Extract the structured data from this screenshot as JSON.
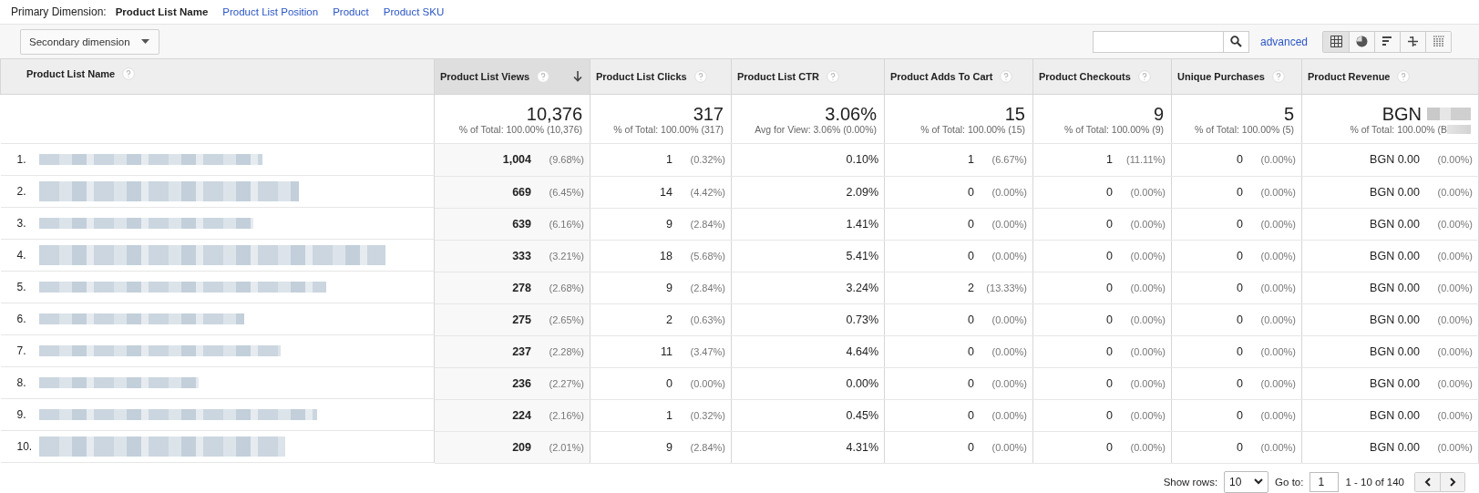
{
  "primary_dimension": {
    "label": "Primary Dimension:",
    "options": [
      {
        "label": "Product List Name",
        "selected": true
      },
      {
        "label": "Product List Position",
        "selected": false
      },
      {
        "label": "Product",
        "selected": false
      },
      {
        "label": "Product SKU",
        "selected": false
      }
    ]
  },
  "toolbar": {
    "secondary_dimension": "Secondary dimension",
    "advanced": "advanced",
    "views": [
      {
        "kind": "table",
        "selected": true
      },
      {
        "kind": "pie",
        "selected": false
      },
      {
        "kind": "performance",
        "selected": false
      },
      {
        "kind": "comparison",
        "selected": false
      },
      {
        "kind": "pivot",
        "selected": false
      }
    ]
  },
  "table": {
    "columns": [
      {
        "label": "Product List Name",
        "sorted": false
      },
      {
        "label": "Product List Views",
        "sorted": true
      },
      {
        "label": "Product List Clicks",
        "sorted": false
      },
      {
        "label": "Product List CTR",
        "sorted": false
      },
      {
        "label": "Product Adds To Cart",
        "sorted": false
      },
      {
        "label": "Product Checkouts",
        "sorted": false
      },
      {
        "label": "Unique Purchases",
        "sorted": false
      },
      {
        "label": "Product Revenue",
        "sorted": false
      }
    ],
    "totals": [
      {
        "kind": "blank"
      },
      {
        "kind": "number",
        "value": "10,376",
        "note": "% of Total: 100.00% (10,376)"
      },
      {
        "kind": "number",
        "value": "317",
        "note": "% of Total: 100.00% (317)"
      },
      {
        "kind": "number",
        "value": "3.06%",
        "note": "Avg for View: 3.06% (0.00%)"
      },
      {
        "kind": "number",
        "value": "15",
        "note": "% of Total: 100.00% (15)"
      },
      {
        "kind": "number",
        "value": "9",
        "note": "% of Total: 100.00% (9)"
      },
      {
        "kind": "number",
        "value": "5",
        "note": "% of Total: 100.00% (5)"
      },
      {
        "kind": "redacted",
        "value": "BGN",
        "note": "% of Total: 100.00% (B"
      }
    ],
    "rows": [
      {
        "cells": [
          {
            "kind": "name",
            "value": "1."
          },
          {
            "value": "1,004",
            "share": "(9.68%)"
          },
          {
            "value": "1",
            "share": "(0.32%)"
          },
          {
            "value": "0.10%"
          },
          {
            "value": "1",
            "share": "(6.67%)"
          },
          {
            "value": "1",
            "share": "(11.11%)"
          },
          {
            "value": "0",
            "share": "(0.00%)"
          },
          {
            "value": "BGN 0.00",
            "share": "(0.00%)"
          }
        ]
      },
      {
        "cells": [
          {
            "kind": "name",
            "value": "2."
          },
          {
            "value": "669",
            "share": "(6.45%)"
          },
          {
            "value": "14",
            "share": "(4.42%)"
          },
          {
            "value": "2.09%"
          },
          {
            "value": "0",
            "share": "(0.00%)"
          },
          {
            "value": "0",
            "share": "(0.00%)"
          },
          {
            "value": "0",
            "share": "(0.00%)"
          },
          {
            "value": "BGN 0.00",
            "share": "(0.00%)"
          }
        ]
      },
      {
        "cells": [
          {
            "kind": "name",
            "value": "3."
          },
          {
            "value": "639",
            "share": "(6.16%)"
          },
          {
            "value": "9",
            "share": "(2.84%)"
          },
          {
            "value": "1.41%"
          },
          {
            "value": "0",
            "share": "(0.00%)"
          },
          {
            "value": "0",
            "share": "(0.00%)"
          },
          {
            "value": "0",
            "share": "(0.00%)"
          },
          {
            "value": "BGN 0.00",
            "share": "(0.00%)"
          }
        ]
      },
      {
        "cells": [
          {
            "kind": "name",
            "value": "4."
          },
          {
            "value": "333",
            "share": "(3.21%)"
          },
          {
            "value": "18",
            "share": "(5.68%)"
          },
          {
            "value": "5.41%"
          },
          {
            "value": "0",
            "share": "(0.00%)"
          },
          {
            "value": "0",
            "share": "(0.00%)"
          },
          {
            "value": "0",
            "share": "(0.00%)"
          },
          {
            "value": "BGN 0.00",
            "share": "(0.00%)"
          }
        ]
      },
      {
        "cells": [
          {
            "kind": "name",
            "value": "5."
          },
          {
            "value": "278",
            "share": "(2.68%)"
          },
          {
            "value": "9",
            "share": "(2.84%)"
          },
          {
            "value": "3.24%"
          },
          {
            "value": "2",
            "share": "(13.33%)"
          },
          {
            "value": "0",
            "share": "(0.00%)"
          },
          {
            "value": "0",
            "share": "(0.00%)"
          },
          {
            "value": "BGN 0.00",
            "share": "(0.00%)"
          }
        ]
      },
      {
        "cells": [
          {
            "kind": "name",
            "value": "6."
          },
          {
            "value": "275",
            "share": "(2.65%)"
          },
          {
            "value": "2",
            "share": "(0.63%)"
          },
          {
            "value": "0.73%"
          },
          {
            "value": "0",
            "share": "(0.00%)"
          },
          {
            "value": "0",
            "share": "(0.00%)"
          },
          {
            "value": "0",
            "share": "(0.00%)"
          },
          {
            "value": "BGN 0.00",
            "share": "(0.00%)"
          }
        ]
      },
      {
        "cells": [
          {
            "kind": "name",
            "value": "7."
          },
          {
            "value": "237",
            "share": "(2.28%)"
          },
          {
            "value": "11",
            "share": "(3.47%)"
          },
          {
            "value": "4.64%"
          },
          {
            "value": "0",
            "share": "(0.00%)"
          },
          {
            "value": "0",
            "share": "(0.00%)"
          },
          {
            "value": "0",
            "share": "(0.00%)"
          },
          {
            "value": "BGN 0.00",
            "share": "(0.00%)"
          }
        ]
      },
      {
        "cells": [
          {
            "kind": "name",
            "value": "8."
          },
          {
            "value": "236",
            "share": "(2.27%)"
          },
          {
            "value": "0",
            "share": "(0.00%)"
          },
          {
            "value": "0.00%"
          },
          {
            "value": "0",
            "share": "(0.00%)"
          },
          {
            "value": "0",
            "share": "(0.00%)"
          },
          {
            "value": "0",
            "share": "(0.00%)"
          },
          {
            "value": "BGN 0.00",
            "share": "(0.00%)"
          }
        ]
      },
      {
        "cells": [
          {
            "kind": "name",
            "value": "9."
          },
          {
            "value": "224",
            "share": "(2.16%)"
          },
          {
            "value": "1",
            "share": "(0.32%)"
          },
          {
            "value": "0.45%"
          },
          {
            "value": "0",
            "share": "(0.00%)"
          },
          {
            "value": "0",
            "share": "(0.00%)"
          },
          {
            "value": "0",
            "share": "(0.00%)"
          },
          {
            "value": "BGN 0.00",
            "share": "(0.00%)"
          }
        ]
      },
      {
        "cells": [
          {
            "kind": "name",
            "value": "10."
          },
          {
            "value": "209",
            "share": "(2.01%)"
          },
          {
            "value": "9",
            "share": "(2.84%)"
          },
          {
            "value": "4.31%"
          },
          {
            "value": "0",
            "share": "(0.00%)"
          },
          {
            "value": "0",
            "share": "(0.00%)"
          },
          {
            "value": "0",
            "share": "(0.00%)"
          },
          {
            "value": "BGN 0.00",
            "share": "(0.00%)"
          }
        ]
      }
    ]
  },
  "pagination": {
    "show_rows_label": "Show rows:",
    "show_rows": "10",
    "goto_label": "Go to:",
    "goto": "1",
    "range": "1 - 10 of 140"
  }
}
